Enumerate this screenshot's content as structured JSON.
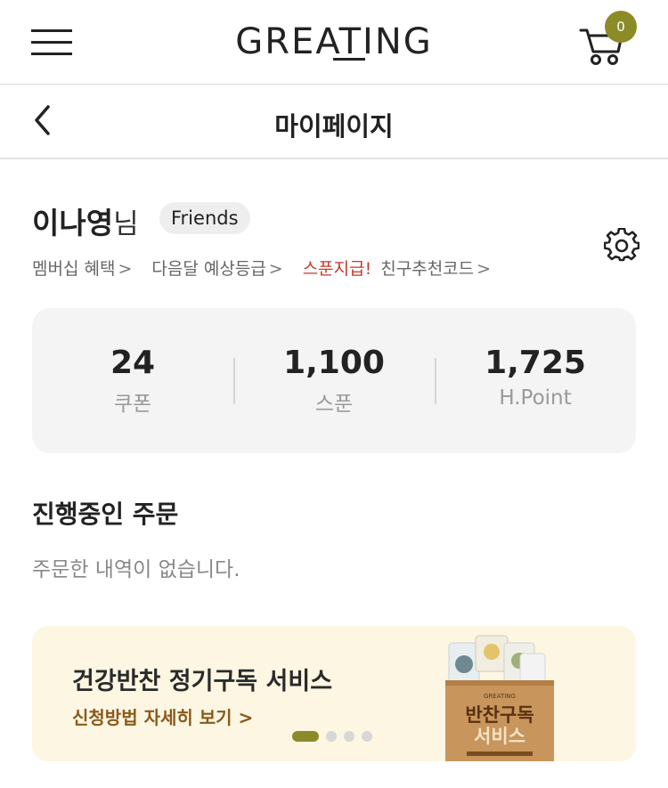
{
  "header": {
    "logo_text": "GREATING",
    "cart_count": "0"
  },
  "titlebar": {
    "title": "마이페이지"
  },
  "profile": {
    "name": "이나영",
    "suffix": "님",
    "grade": "Friends",
    "links": [
      {
        "label": "멤버십 혜택",
        "chevron": ">"
      },
      {
        "label": "다음달 예상등급",
        "chevron": ">"
      },
      {
        "highlight": "스푼지급!",
        "label": "친구추천코드",
        "chevron": ">"
      }
    ]
  },
  "stats": [
    {
      "value": "24",
      "label": "쿠폰"
    },
    {
      "value": "1,100",
      "label": "스푼"
    },
    {
      "value": "1,725",
      "label": "H.Point"
    }
  ],
  "orders": {
    "title": "진행중인 주문",
    "empty_message": "주문한 내역이 없습니다."
  },
  "banner": {
    "title": "건강반찬 정기구독 서비스",
    "link": "신청방법 자세히 보기 >",
    "product_text_top": "반찬구독",
    "product_text_bottom": "서비스",
    "product_brand": "GREATING",
    "slides_total": 4,
    "active_slide": 1
  },
  "colors": {
    "accent": "#8b8b28",
    "highlight": "#c0392b",
    "banner_bg": "#fcf6e2",
    "banner_link": "#8a5a1c",
    "stats_bg": "#f4f4f4"
  }
}
